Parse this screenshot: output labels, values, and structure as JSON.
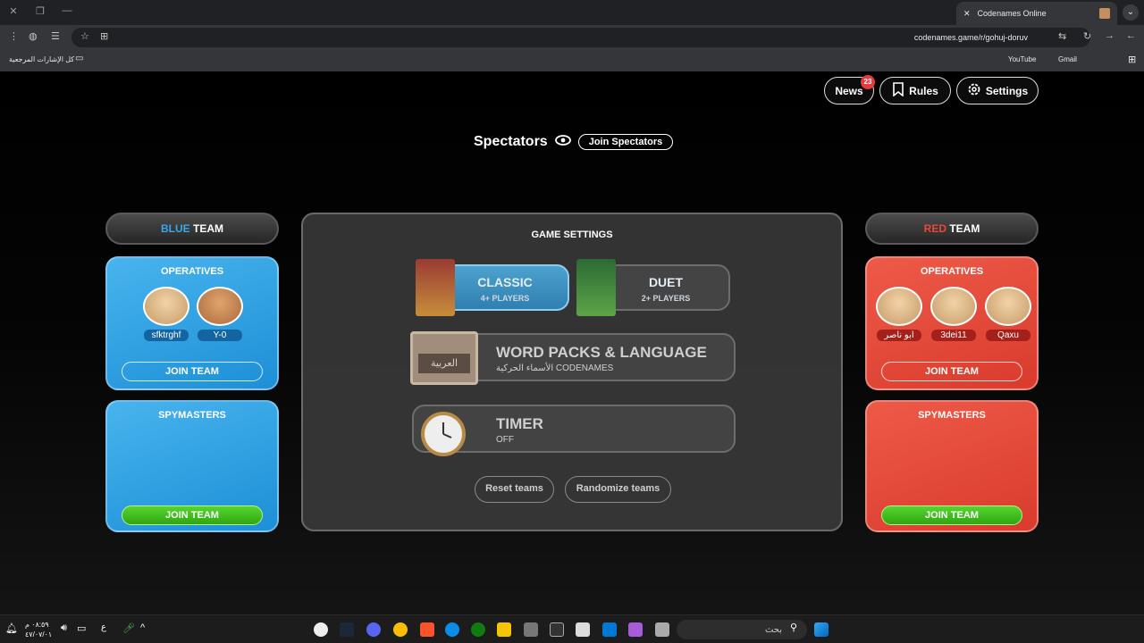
{
  "browser": {
    "tab_title": "Codenames Online",
    "url": "codenames.game/r/gohuj-doruv",
    "bookmarks_folder": "كل الإشارات المرجعية",
    "bookmark_youtube": "YouTube",
    "bookmark_gmail": "Gmail"
  },
  "header": {
    "news_label": "News",
    "news_count": "23",
    "rules_label": "Rules",
    "settings_label": "Settings"
  },
  "spectators": {
    "label": "Spectators",
    "join_label": "Join Spectators"
  },
  "blue_team": {
    "title_colored": "BLUE",
    "title_rest": " TEAM",
    "color": "#3aa6e6",
    "operatives_label": "OPERATIVES",
    "operatives": [
      "sfktrghf",
      "Y-0"
    ],
    "join_operatives": "JOIN TEAM",
    "spymasters_label": "SPYMASTERS",
    "join_spymasters": "JOIN TEAM"
  },
  "red_team": {
    "title_colored": "RED",
    "title_rest": " TEAM",
    "color": "#e8473a",
    "operatives_label": "OPERATIVES",
    "operatives": [
      "ابو ناصر",
      "3dei11",
      "Qaxu"
    ],
    "join_operatives": "JOIN TEAM",
    "spymasters_label": "SPYMASTERS",
    "join_spymasters": "JOIN TEAM"
  },
  "game_settings": {
    "title": "GAME SETTINGS",
    "classic": {
      "title": "CLASSIC",
      "sub": "4+ PLAYERS"
    },
    "duet": {
      "title": "DUET",
      "sub": "2+ PLAYERS"
    },
    "word_packs": {
      "title": "WORD PACKS & LANGUAGE",
      "sub": "الأسماء الحركية CODENAMES",
      "badge": "العربية"
    },
    "timer": {
      "title": "TIMER",
      "sub": "OFF"
    },
    "reset_label": "Reset teams",
    "randomize_label": "Randomize teams"
  },
  "taskbar": {
    "search_placeholder": "بحث",
    "time": "٠٨:٥٩ م",
    "date": "٤٧/٠٧/٠١",
    "lang": "ع"
  }
}
